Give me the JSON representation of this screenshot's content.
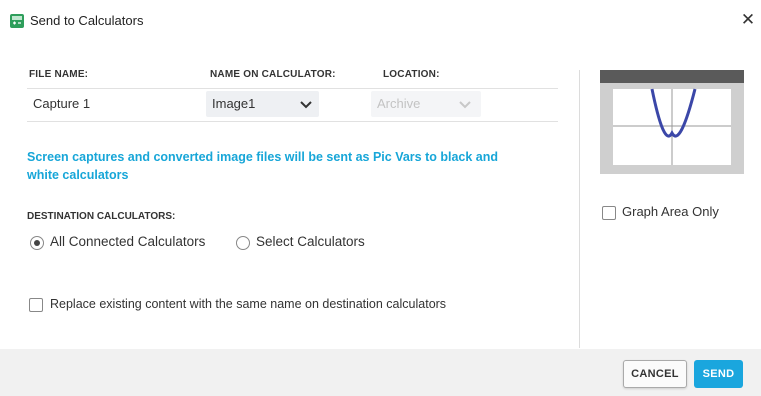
{
  "window": {
    "title": "Send to Calculators",
    "app_icon": "calculator-app-icon",
    "close_glyph": "✕"
  },
  "table": {
    "headers": {
      "file_name": "FILE NAME:",
      "name_on_calculator": "NAME ON CALCULATOR:",
      "location": "LOCATION:"
    },
    "row": {
      "file_name": "Capture 1",
      "name_on_calculator": "Image1",
      "location": "Archive",
      "location_enabled": false
    }
  },
  "info_message": "Screen captures and converted image files will be sent as Pic Vars to black and white calculators",
  "destination": {
    "label": "DESTINATION CALCULATORS:",
    "options": [
      {
        "label": "All Connected Calculators",
        "selected": true
      },
      {
        "label": "Select Calculators",
        "selected": false
      }
    ]
  },
  "replace_option": {
    "label": "Replace existing content with the same name on destination calculators",
    "checked": false
  },
  "graph_area_only": {
    "label": "Graph Area Only",
    "checked": false
  },
  "buttons": {
    "cancel": "CANCEL",
    "send": "SEND"
  },
  "colors": {
    "accent": "#1aa6de",
    "info_text": "#17a6d8",
    "footer_bg": "#f1f1f1",
    "parabola": "#3b47a8"
  }
}
